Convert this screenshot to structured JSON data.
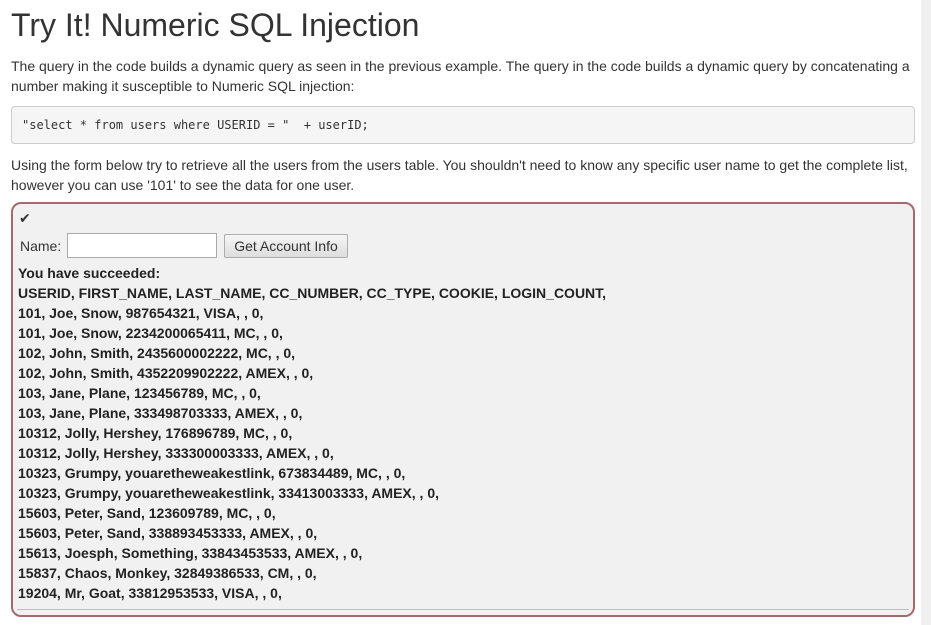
{
  "lesson": {
    "title": "Try It! Numeric SQL Injection",
    "intro": "The query in the code builds a dynamic query as seen in the previous example. The query in the code builds a dynamic query by concatenating a number making it susceptible to Numeric SQL injection:",
    "code": "\"select * from users where USERID = \"  + userID;",
    "instructions": "Using the form below try to retrieve all the users from the users table. You shouldn't need to know any specific user name to get the complete list, however you can use '101' to see the data for one user."
  },
  "attack": {
    "status_icon": "checkmark-icon",
    "border_color": "#a46a6c",
    "name_label": "Name:",
    "name_value": "",
    "submit_label": "Get Account Info",
    "result_heading": "You have succeeded:",
    "result_lines": [
      "USERID, FIRST_NAME, LAST_NAME, CC_NUMBER, CC_TYPE, COOKIE, LOGIN_COUNT,",
      "101, Joe, Snow, 987654321, VISA, , 0,",
      "101, Joe, Snow, 2234200065411, MC, , 0,",
      "102, John, Smith, 2435600002222, MC, , 0,",
      "102, John, Smith, 4352209902222, AMEX, , 0,",
      "103, Jane, Plane, 123456789, MC, , 0,",
      "103, Jane, Plane, 333498703333, AMEX, , 0,",
      "10312, Jolly, Hershey, 176896789, MC, , 0,",
      "10312, Jolly, Hershey, 333300003333, AMEX, , 0,",
      "10323, Grumpy, youaretheweakestlink, 673834489, MC, , 0,",
      "10323, Grumpy, youaretheweakestlink, 33413003333, AMEX, , 0,",
      "15603, Peter, Sand, 123609789, MC, , 0,",
      "15603, Peter, Sand, 338893453333, AMEX, , 0,",
      "15613, Joesph, Something, 33843453533, AMEX, , 0,",
      "15837, Chaos, Monkey, 32849386533, CM, , 0,",
      "19204, Mr, Goat, 33812953533, VISA, , 0,"
    ]
  }
}
